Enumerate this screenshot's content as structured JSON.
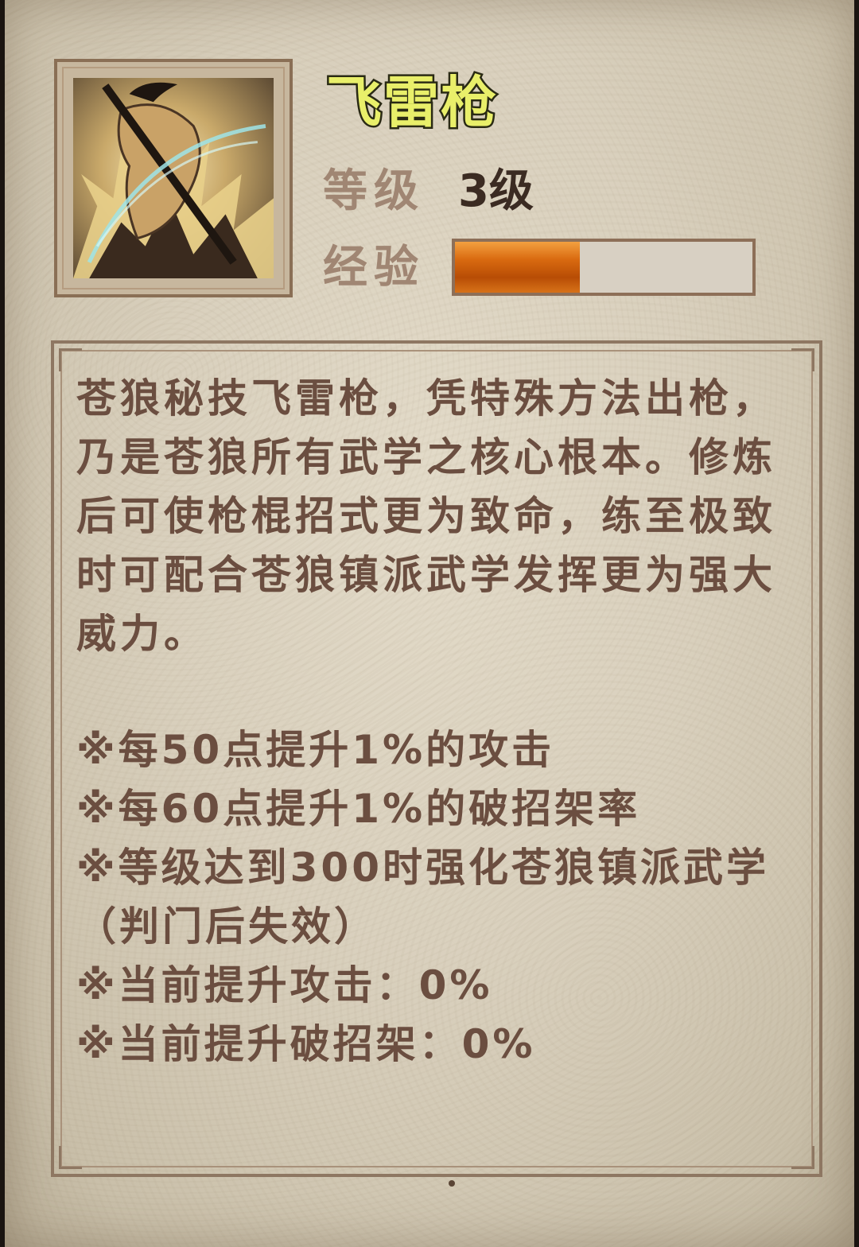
{
  "skill": {
    "name": "飞雷枪",
    "level_label": "等级",
    "level_value": "3级",
    "exp_label": "经验",
    "exp_progress": 0.42
  },
  "description": "苍狼秘技飞雷枪，凭特殊方法出枪，乃是苍狼所有武学之核心根本。修炼后可使枪棍招式更为致命，练至极致时可配合苍狼镇派武学发挥更为强大威力。",
  "effects": [
    "※每50点提升1%的攻击",
    "※每60点提升1%的破招架率",
    "※等级达到300时强化苍狼镇派武学（判门后失效）",
    "※当前提升攻击：0%",
    "※当前提升破招架：0%"
  ],
  "icons": {
    "skill_icon": "spear-warrior-icon"
  },
  "colors": {
    "title": "#e9ef6a",
    "label": "#a08673",
    "text": "#6b4e40",
    "exp_fill": "#d96a10"
  }
}
